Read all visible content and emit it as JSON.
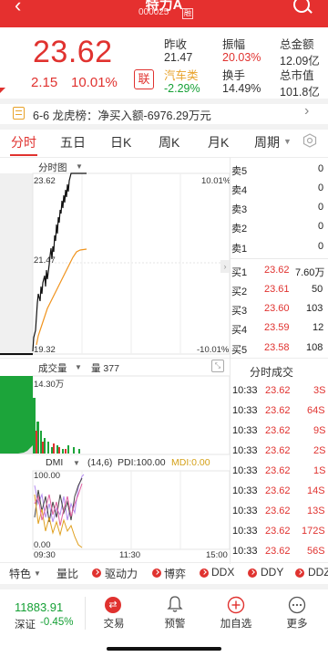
{
  "header": {
    "title": "特力A",
    "code": "000025",
    "badge": "融"
  },
  "quote": {
    "price": "23.62",
    "change": "2.15",
    "change_pct": "10.01%",
    "lian_label": "联",
    "stats": [
      {
        "label": "昨收",
        "value": "21.47"
      },
      {
        "label": "振幅",
        "value": "20.03%"
      },
      {
        "label": "总金额",
        "value": "12.09亿"
      },
      {
        "label": "汽车类",
        "value": "-2.29%"
      },
      {
        "label": "换手",
        "value": "14.49%"
      },
      {
        "label": "总市值",
        "value": "101.8亿"
      }
    ]
  },
  "dragon": {
    "text": "6-6 龙虎榜：净买入额-6976.29万元"
  },
  "tabs": [
    "分时",
    "五日",
    "日K",
    "周K",
    "月K",
    "周期"
  ],
  "tabs_active": "分时",
  "intraday": {
    "chart_title": "分时图",
    "price_high": "23.62",
    "price_mid": "21.47",
    "price_low": "19.32",
    "pct_high": "10.01%",
    "pct_low": "-10.01%"
  },
  "order_book": {
    "asks": [
      {
        "label": "卖5",
        "price": "",
        "vol": "0"
      },
      {
        "label": "卖4",
        "price": "",
        "vol": "0"
      },
      {
        "label": "卖3",
        "price": "",
        "vol": "0"
      },
      {
        "label": "卖2",
        "price": "",
        "vol": "0"
      },
      {
        "label": "卖1",
        "price": "",
        "vol": "0"
      }
    ],
    "bids": [
      {
        "label": "买1",
        "price": "23.62",
        "vol": "7.60万"
      },
      {
        "label": "买2",
        "price": "23.61",
        "vol": "50"
      },
      {
        "label": "买3",
        "price": "23.60",
        "vol": "103"
      },
      {
        "label": "买4",
        "price": "23.59",
        "vol": "12"
      },
      {
        "label": "买5",
        "price": "23.58",
        "vol": "108"
      }
    ]
  },
  "volume": {
    "title": "成交量",
    "qty_label": "量 377",
    "max_label": "14.30万"
  },
  "trades": {
    "title": "分时成交",
    "rows": [
      {
        "time": "10:33",
        "price": "23.62",
        "vol": "3S"
      },
      {
        "time": "10:33",
        "price": "23.62",
        "vol": "64S"
      },
      {
        "time": "10:33",
        "price": "23.62",
        "vol": "9S"
      },
      {
        "time": "10:33",
        "price": "23.62",
        "vol": "2S"
      },
      {
        "time": "10:33",
        "price": "23.62",
        "vol": "1S"
      },
      {
        "time": "10:33",
        "price": "23.62",
        "vol": "14S"
      },
      {
        "time": "10:33",
        "price": "23.62",
        "vol": "13S"
      },
      {
        "time": "10:33",
        "price": "23.62",
        "vol": "172S"
      },
      {
        "time": "10:33",
        "price": "23.62",
        "vol": "56S"
      }
    ]
  },
  "dmi": {
    "title": "DMI",
    "params": "(14,6)",
    "pdi": "PDI:100.00",
    "mdi": "MDI:0.00",
    "y_top": "100.00",
    "y_bottom": "0.00",
    "t_start": "09:30",
    "t_mid": "11:30",
    "t_end": "15:00"
  },
  "bottom_tabs": [
    "特色",
    "量比",
    "驱动力",
    "博弈",
    "DDX",
    "DDY",
    "DDZ"
  ],
  "index": {
    "value": "11883.91",
    "name": "深证",
    "change": "-0.45%"
  },
  "nav": [
    "交易",
    "预警",
    "加自选",
    "更多"
  ],
  "colors": {
    "accent": "#e0322f",
    "up": "#e0322f",
    "down": "#15a035",
    "avg_line": "#f0941e"
  }
}
